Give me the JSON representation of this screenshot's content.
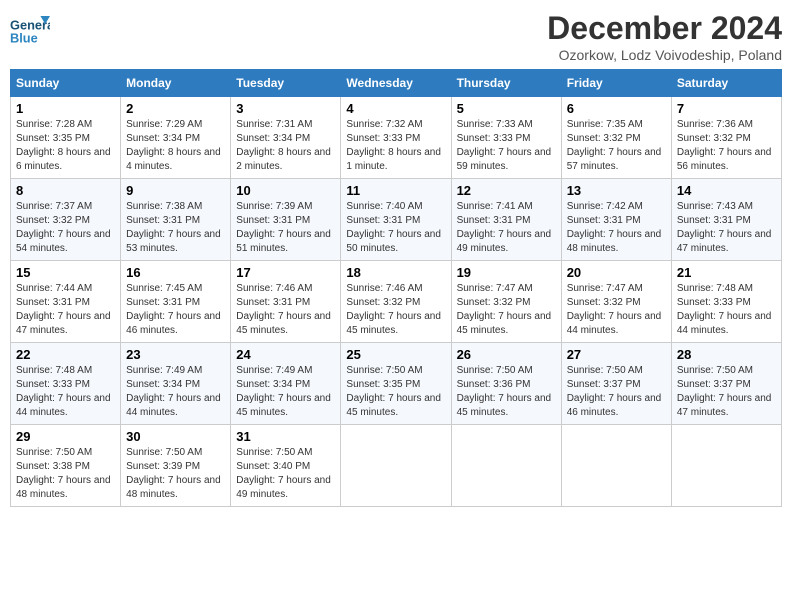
{
  "logo": {
    "general": "General",
    "blue": "Blue"
  },
  "title": "December 2024",
  "subtitle": "Ozorkow, Lodz Voivodeship, Poland",
  "weekdays": [
    "Sunday",
    "Monday",
    "Tuesday",
    "Wednesday",
    "Thursday",
    "Friday",
    "Saturday"
  ],
  "weeks": [
    [
      {
        "day": "1",
        "sunrise": "7:28 AM",
        "sunset": "3:35 PM",
        "daylight": "8 hours and 6 minutes."
      },
      {
        "day": "2",
        "sunrise": "7:29 AM",
        "sunset": "3:34 PM",
        "daylight": "8 hours and 4 minutes."
      },
      {
        "day": "3",
        "sunrise": "7:31 AM",
        "sunset": "3:34 PM",
        "daylight": "8 hours and 2 minutes."
      },
      {
        "day": "4",
        "sunrise": "7:32 AM",
        "sunset": "3:33 PM",
        "daylight": "8 hours and 1 minute."
      },
      {
        "day": "5",
        "sunrise": "7:33 AM",
        "sunset": "3:33 PM",
        "daylight": "7 hours and 59 minutes."
      },
      {
        "day": "6",
        "sunrise": "7:35 AM",
        "sunset": "3:32 PM",
        "daylight": "7 hours and 57 minutes."
      },
      {
        "day": "7",
        "sunrise": "7:36 AM",
        "sunset": "3:32 PM",
        "daylight": "7 hours and 56 minutes."
      }
    ],
    [
      {
        "day": "8",
        "sunrise": "7:37 AM",
        "sunset": "3:32 PM",
        "daylight": "7 hours and 54 minutes."
      },
      {
        "day": "9",
        "sunrise": "7:38 AM",
        "sunset": "3:31 PM",
        "daylight": "7 hours and 53 minutes."
      },
      {
        "day": "10",
        "sunrise": "7:39 AM",
        "sunset": "3:31 PM",
        "daylight": "7 hours and 51 minutes."
      },
      {
        "day": "11",
        "sunrise": "7:40 AM",
        "sunset": "3:31 PM",
        "daylight": "7 hours and 50 minutes."
      },
      {
        "day": "12",
        "sunrise": "7:41 AM",
        "sunset": "3:31 PM",
        "daylight": "7 hours and 49 minutes."
      },
      {
        "day": "13",
        "sunrise": "7:42 AM",
        "sunset": "3:31 PM",
        "daylight": "7 hours and 48 minutes."
      },
      {
        "day": "14",
        "sunrise": "7:43 AM",
        "sunset": "3:31 PM",
        "daylight": "7 hours and 47 minutes."
      }
    ],
    [
      {
        "day": "15",
        "sunrise": "7:44 AM",
        "sunset": "3:31 PM",
        "daylight": "7 hours and 47 minutes."
      },
      {
        "day": "16",
        "sunrise": "7:45 AM",
        "sunset": "3:31 PM",
        "daylight": "7 hours and 46 minutes."
      },
      {
        "day": "17",
        "sunrise": "7:46 AM",
        "sunset": "3:31 PM",
        "daylight": "7 hours and 45 minutes."
      },
      {
        "day": "18",
        "sunrise": "7:46 AM",
        "sunset": "3:32 PM",
        "daylight": "7 hours and 45 minutes."
      },
      {
        "day": "19",
        "sunrise": "7:47 AM",
        "sunset": "3:32 PM",
        "daylight": "7 hours and 45 minutes."
      },
      {
        "day": "20",
        "sunrise": "7:47 AM",
        "sunset": "3:32 PM",
        "daylight": "7 hours and 44 minutes."
      },
      {
        "day": "21",
        "sunrise": "7:48 AM",
        "sunset": "3:33 PM",
        "daylight": "7 hours and 44 minutes."
      }
    ],
    [
      {
        "day": "22",
        "sunrise": "7:48 AM",
        "sunset": "3:33 PM",
        "daylight": "7 hours and 44 minutes."
      },
      {
        "day": "23",
        "sunrise": "7:49 AM",
        "sunset": "3:34 PM",
        "daylight": "7 hours and 44 minutes."
      },
      {
        "day": "24",
        "sunrise": "7:49 AM",
        "sunset": "3:34 PM",
        "daylight": "7 hours and 45 minutes."
      },
      {
        "day": "25",
        "sunrise": "7:50 AM",
        "sunset": "3:35 PM",
        "daylight": "7 hours and 45 minutes."
      },
      {
        "day": "26",
        "sunrise": "7:50 AM",
        "sunset": "3:36 PM",
        "daylight": "7 hours and 45 minutes."
      },
      {
        "day": "27",
        "sunrise": "7:50 AM",
        "sunset": "3:37 PM",
        "daylight": "7 hours and 46 minutes."
      },
      {
        "day": "28",
        "sunrise": "7:50 AM",
        "sunset": "3:37 PM",
        "daylight": "7 hours and 47 minutes."
      }
    ],
    [
      {
        "day": "29",
        "sunrise": "7:50 AM",
        "sunset": "3:38 PM",
        "daylight": "7 hours and 48 minutes."
      },
      {
        "day": "30",
        "sunrise": "7:50 AM",
        "sunset": "3:39 PM",
        "daylight": "7 hours and 48 minutes."
      },
      {
        "day": "31",
        "sunrise": "7:50 AM",
        "sunset": "3:40 PM",
        "daylight": "7 hours and 49 minutes."
      },
      null,
      null,
      null,
      null
    ]
  ]
}
